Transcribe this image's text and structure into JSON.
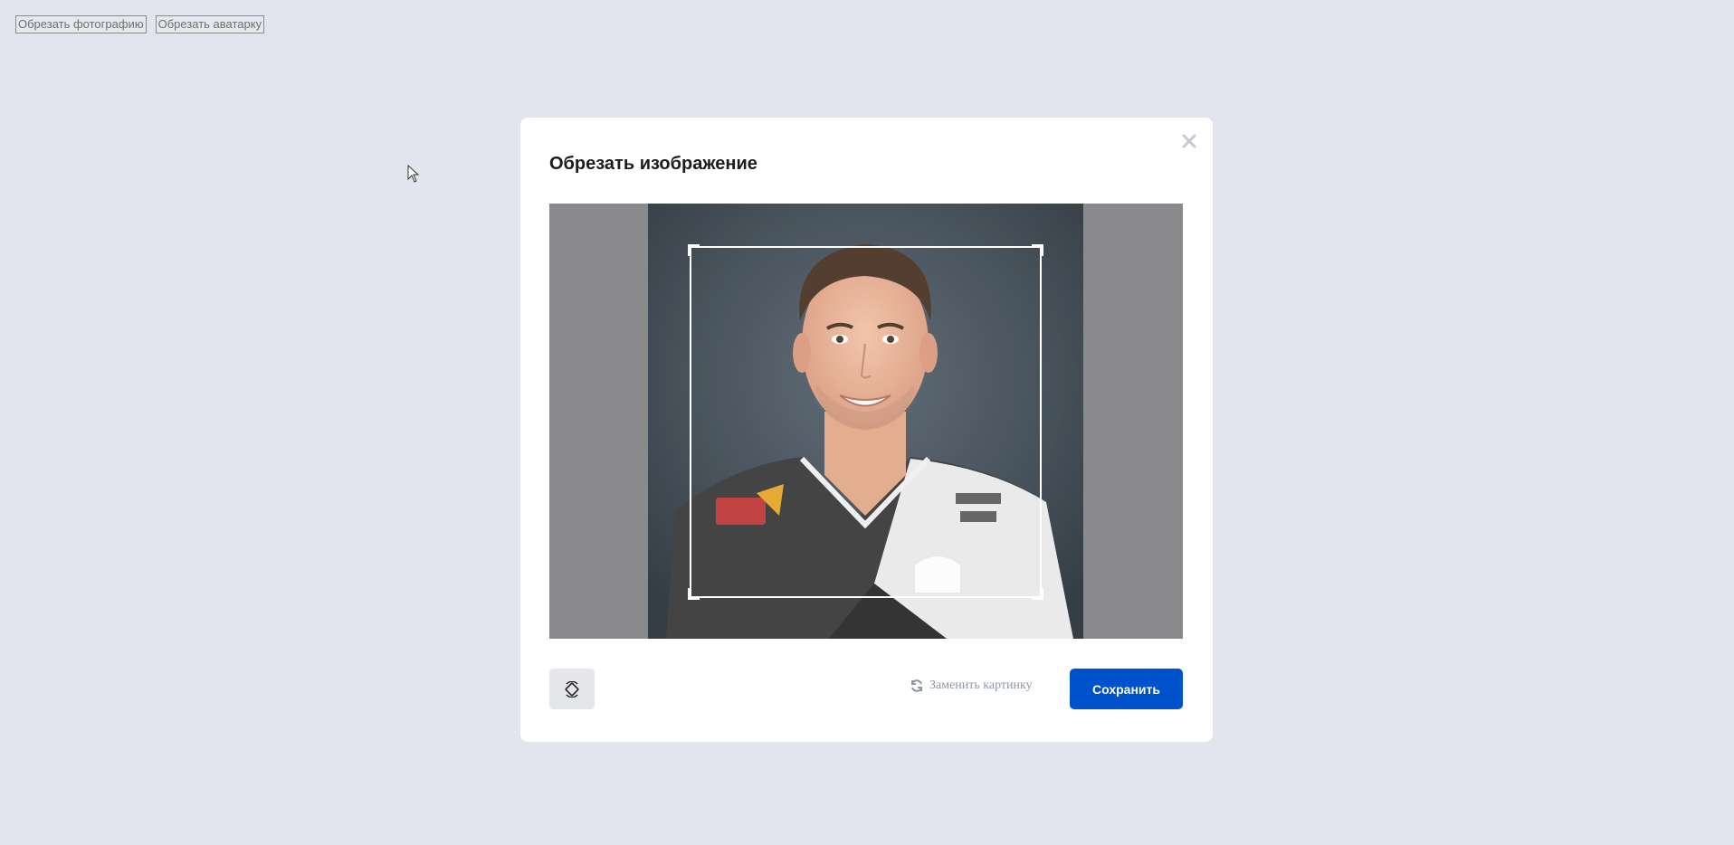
{
  "top_buttons": {
    "crop_photo_label": "Обрезать фотографию",
    "crop_avatar_label": "Обрезать аватарку"
  },
  "modal": {
    "title": "Обрезать изображение",
    "close_icon": "close-icon",
    "replace_label": "Заменить картинку",
    "replace_icon": "refresh-icon",
    "rotate_icon": "rotate-icon",
    "save_label": "Сохранить"
  },
  "colors": {
    "page_background": "#e2e5ed",
    "accent": "#0052cc",
    "crop_background": "#8a8a8c"
  }
}
